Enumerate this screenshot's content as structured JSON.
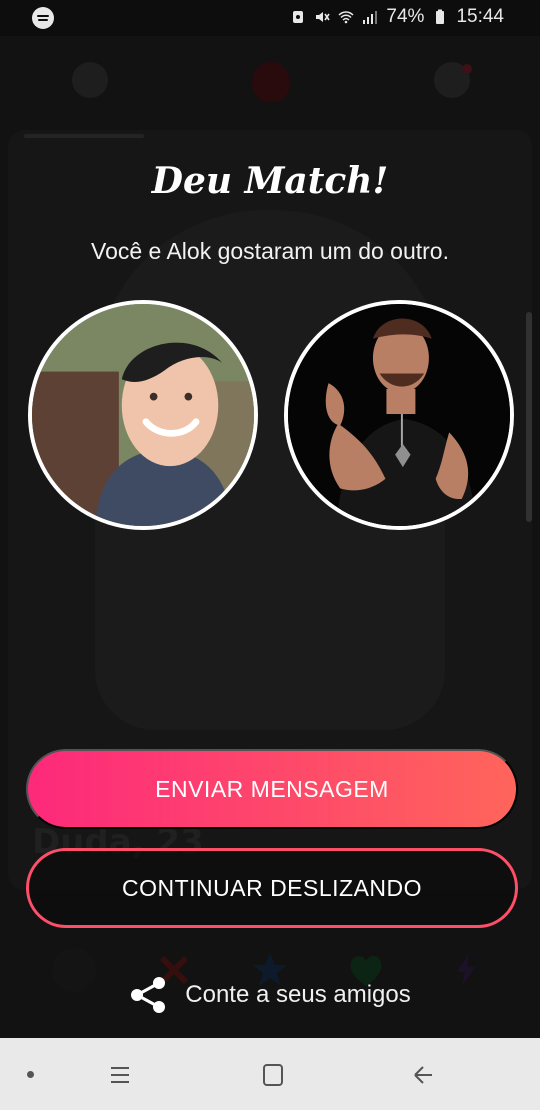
{
  "status_bar": {
    "battery_percent": "74%",
    "time": "15:44",
    "left_icon": "spotify-icon",
    "right_icons": [
      "alarm-icon",
      "mute-icon",
      "wifi-icon",
      "signal-icon",
      "battery-icon"
    ]
  },
  "background_card": {
    "name_text": "Duda, 23"
  },
  "match": {
    "title": "Deu Match!",
    "subtitle": "Você e Alok gostaram um do outro.",
    "left_avatar_icon": "user-avatar-left",
    "right_avatar_icon": "user-avatar-right"
  },
  "buttons": {
    "send_message": "ENVIAR MENSAGEM",
    "keep_swiping": "CONTINUAR DESLIZANDO"
  },
  "share": {
    "label": "Conte a seus amigos",
    "icon": "share-icon"
  },
  "colors": {
    "gradient_start": "#fd297b",
    "gradient_end": "#ff655b",
    "secondary_border": "#fd5068"
  },
  "bottom_nav": {
    "icons": [
      "recent-apps-icon",
      "home-icon",
      "back-icon"
    ]
  }
}
